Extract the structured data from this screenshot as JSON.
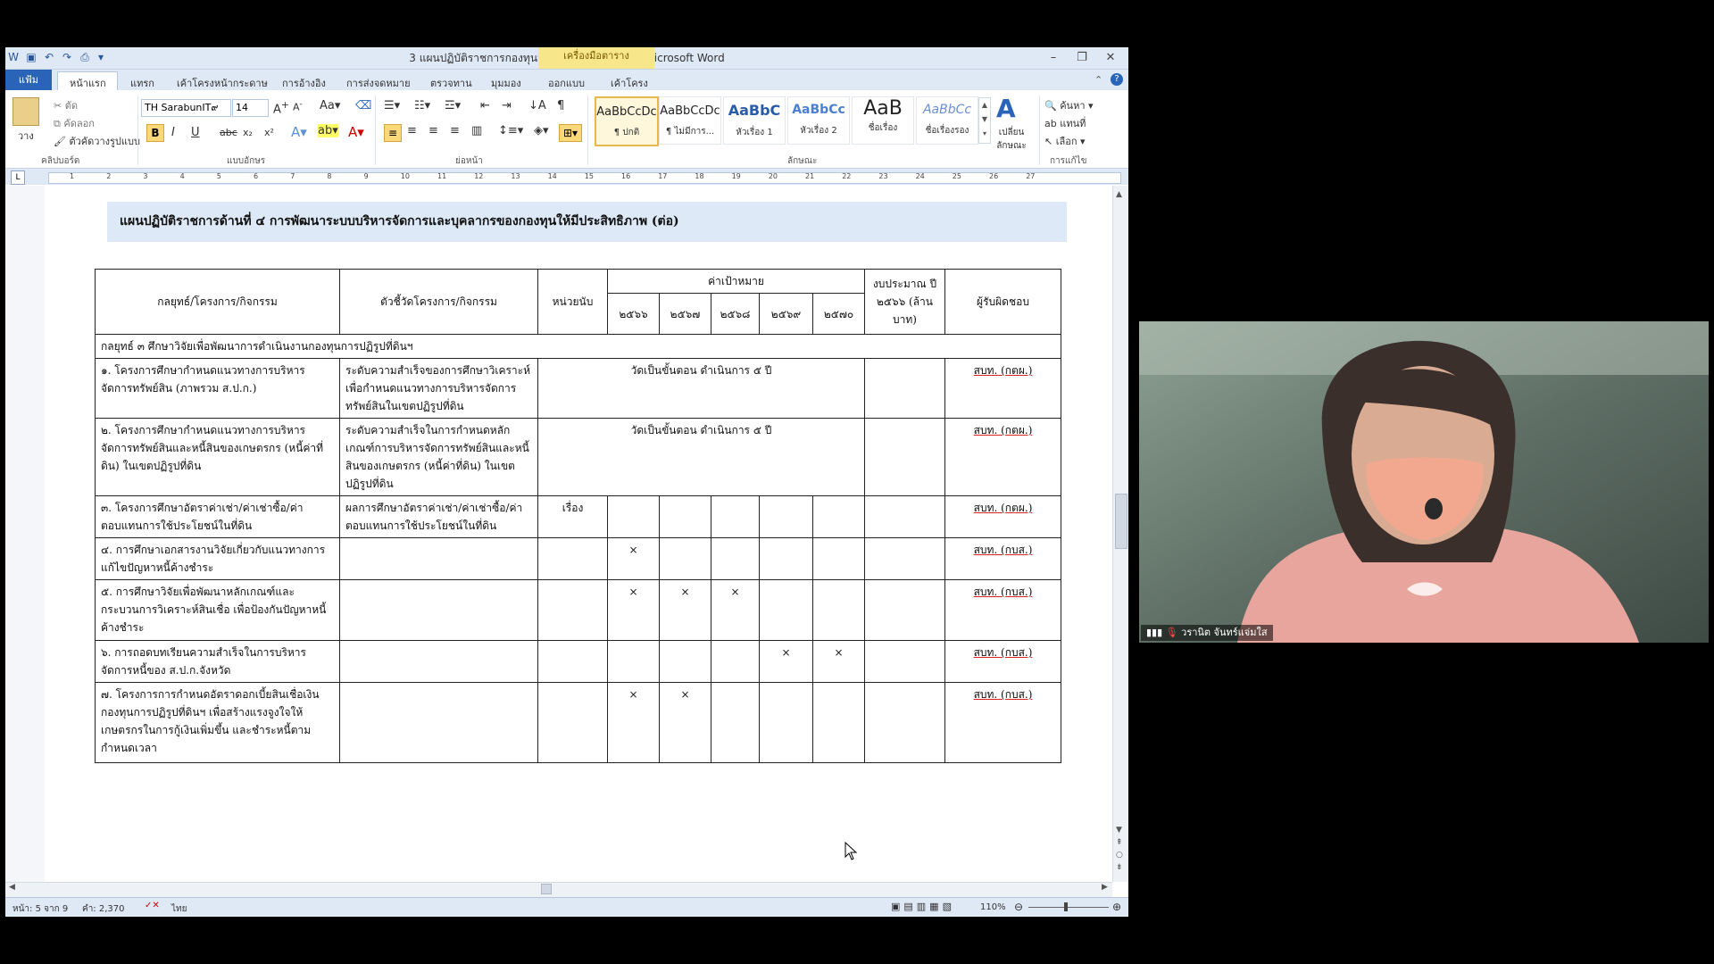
{
  "window": {
    "title": "3 แผนปฏิบัติราชการกองทุนฯ 2566-2570.docx - Microsoft Word",
    "context_tab": "เครื่องมือตาราง",
    "qat_icons": [
      "word-icon",
      "save-icon",
      "undo-icon",
      "redo-icon",
      "print-preview-icon"
    ]
  },
  "tabs": [
    "แฟ้ม",
    "หน้าแรก",
    "แทรก",
    "เค้าโครงหน้ากระดาษ",
    "การอ้างอิง",
    "การส่งจดหมาย",
    "ตรวจทาน",
    "มุมมอง",
    "ออกแบบ",
    "เค้าโครง"
  ],
  "ribbon": {
    "clipboard": {
      "paste": "วาง",
      "cut": "ตัด",
      "copy": "คัดลอก",
      "format_painter": "ตัวคัดวางรูปแบบ",
      "label": "คลิปบอร์ด"
    },
    "font": {
      "name": "TH SarabunIT๙",
      "size": "14",
      "label": "แบบอักษร",
      "bold": "B",
      "italic": "I",
      "underline": "U",
      "strike": "abc",
      "sub": "x₂",
      "sup": "x²"
    },
    "paragraph": {
      "label": "ย่อหน้า"
    },
    "styles": {
      "label": "ลักษณะ",
      "items": [
        {
          "sample": "AaBbCcDc",
          "name": "¶ ปกติ"
        },
        {
          "sample": "AaBbCcDc",
          "name": "¶ ไม่มีการ..."
        },
        {
          "sample": "AaBbC",
          "name": "หัวเรื่อง 1"
        },
        {
          "sample": "AaBbCc",
          "name": "หัวเรื่อง 2"
        },
        {
          "sample": "AaB",
          "name": "ชื่อเรื่อง"
        },
        {
          "sample": "AaBbCc",
          "name": "ชื่อเรื่องรอง"
        }
      ],
      "change": "เปลี่ยน ลักษณะ"
    },
    "editing": {
      "find": "ค้นหา",
      "replace": "แทนที่",
      "select": "เลือก",
      "label": "การแก้ไข"
    }
  },
  "ruler_numbers": [
    "1",
    "2",
    "3",
    "4",
    "5",
    "6",
    "7",
    "8",
    "9",
    "10",
    "11",
    "12",
    "13",
    "14",
    "15",
    "16",
    "17",
    "18",
    "19",
    "20",
    "21",
    "22",
    "23",
    "24",
    "25",
    "26",
    "27"
  ],
  "document": {
    "heading": "แผนปฏิบัติราชการด้านที่ ๔ การพัฒนาระบบบริหารจัดการและบุคลากรของกองทุนให้มีประสิทธิภาพ (ต่อ)",
    "headers": {
      "strategy": "กลยุทธ์/โครงการ/กิจกรรม",
      "indicator": "ตัวชี้วัดโครงการ/กิจกรรม",
      "unit": "หน่วยนับ",
      "target": "ค่าเป้าหมาย",
      "years": [
        "๒๕๖๖",
        "๒๕๖๗",
        "๒๕๖๘",
        "๒๕๖๙",
        "๒๕๗๐"
      ],
      "budget": "งบประมาณ ปี ๒๕๖๖ (ล้านบาท)",
      "owner": "ผู้รับผิดชอบ"
    },
    "strategy_row": "กลยุทธ์ ๓ ศึกษาวิจัยเพื่อพัฒนาการดำเนินงานกองทุนการปฏิรูปที่ดินฯ",
    "rows": [
      {
        "project": "๑. โครงการศึกษากำหนดแนวทางการบริหารจัดการทรัพย์สิน (ภาพรวม ส.ป.ก.)",
        "indicator": "ระดับความสำเร็จของการศึกษาวิเคราะห์เพื่อกำหนดแนวทางการบริหารจัดการทรัพย์สินในเขตปฏิรูปที่ดิน",
        "target_text": "วัดเป็นขั้นตอน ดำเนินการ ๕ ปี",
        "owner": "สบท. (กตผ.)"
      },
      {
        "project": "๒. โครงการศึกษากำหนดแนวทางการบริหารจัดการทรัพย์สินและหนี้สินของเกษตรกร (หนี้ค่าที่ดิน) ในเขตปฏิรูปที่ดิน",
        "indicator": "ระดับความสำเร็จในการกำหนดหลักเกณฑ์การบริหารจัดการทรัพย์สินและหนี้สินของเกษตรกร (หนี้ค่าที่ดิน) ในเขตปฏิรูปที่ดิน",
        "target_text": "วัดเป็นขั้นตอน ดำเนินการ ๕ ปี",
        "owner": "สบท. (กตผ.)"
      },
      {
        "project": "๓. โครงการศึกษาอัตราค่าเช่า/ค่าเช่าซื้อ/ค่าตอบแทนการใช้ประโยชน์ในที่ดิน",
        "indicator": "ผลการศึกษาอัตราค่าเช่า/ค่าเช่าซื้อ/ค่าตอบแทนการใช้ประโยชน์ในที่ดิน",
        "unit": "เรื่อง",
        "marks": [
          "",
          "",
          "",
          "",
          ""
        ],
        "owner": "สบท. (กตผ.)"
      },
      {
        "project": "๔. การศึกษาเอกสารงานวิจัยเกี่ยวกับแนวทางการแก้ไขปัญหาหนี้ค้างชำระ",
        "indicator": "",
        "unit": "",
        "marks": [
          "×",
          "",
          "",
          "",
          ""
        ],
        "owner": "สบท. (กบส.)"
      },
      {
        "project": "๕. การศึกษาวิจัยเพื่อพัฒนาหลักเกณฑ์และกระบวนการวิเคราะห์สินเชื่อ เพื่อป้องกันปัญหาหนี้ค้างชำระ",
        "indicator": "",
        "unit": "",
        "marks": [
          "×",
          "×",
          "×",
          "",
          ""
        ],
        "owner": "สบท. (กบส.)"
      },
      {
        "project": "๖. การถอดบทเรียนความสำเร็จในการบริหารจัดการหนี้ของ ส.ป.ก.จังหวัด",
        "indicator": "",
        "unit": "",
        "marks": [
          "",
          "",
          "",
          "×",
          "×"
        ],
        "owner": "สบท. (กบส.)"
      },
      {
        "project": "๗. โครงการการกำหนดอัตราดอกเบี้ยสินเชื่อเงินกองทุนการปฏิรูปที่ดินฯ เพื่อสร้างแรงจูงใจให้เกษตรกรในการกู้เงินเพิ่มขึ้น และชำระหนี้ตามกำหนดเวลา",
        "indicator": "",
        "unit": "",
        "marks": [
          "×",
          "×",
          "",
          "",
          ""
        ],
        "owner": "สบท. (กบส.)"
      }
    ]
  },
  "status": {
    "page": "หน้า: 5 จาก 9",
    "words": "คำ: 2,370",
    "language": "ไทย",
    "zoom": "110%"
  },
  "video": {
    "participant": "วรานิต จันทร์แจ่มใส"
  }
}
